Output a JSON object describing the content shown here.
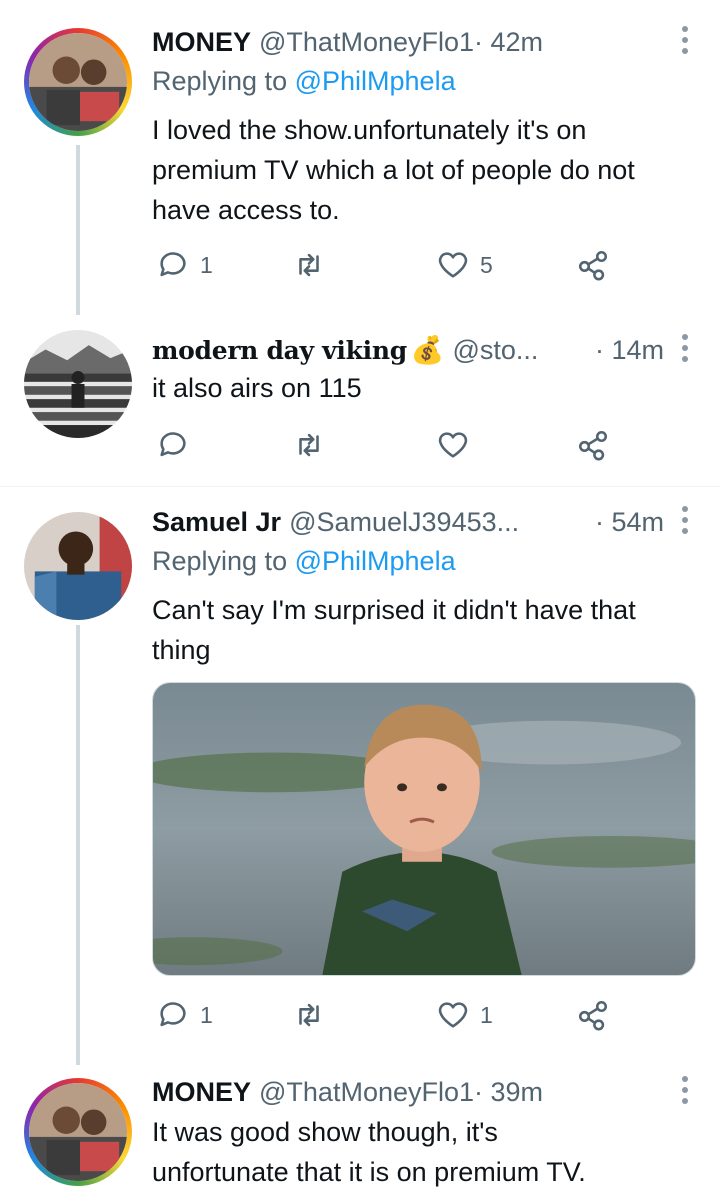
{
  "colors": {
    "link": "#1d9bf0",
    "muted": "#536471",
    "text": "#0f1419",
    "line": "#cfd9de"
  },
  "tweets": [
    {
      "name": "MONEY",
      "handle": "@ThatMoneyFlo1",
      "sep_time": " · 42m",
      "reply_prefix": "Replying to ",
      "reply_mention": "@PhilMphela",
      "line1": "I loved the show.unfortunately it's on",
      "line2": "premium TV which a lot of people do not",
      "line3": "have access to.",
      "replies": "1",
      "retweets": "",
      "likes": "5"
    },
    {
      "name": "modern day viking",
      "emoji": "💰",
      "handle": "@sto...",
      "sep_time": "· 14m",
      "line1": "it also airs on 115",
      "replies": "",
      "retweets": "",
      "likes": ""
    },
    {
      "name": "Samuel Jr",
      "handle": "@SamuelJ39453...",
      "sep_time": "· 54m",
      "reply_prefix": "Replying to ",
      "reply_mention": "@PhilMphela",
      "line1": "Can't say I'm surprised it didn't have that",
      "line2": "thing",
      "media_description_icon": "photo-icon",
      "replies": "1",
      "retweets": "",
      "likes": "1"
    },
    {
      "name": "MONEY",
      "handle": "@ThatMoneyFlo1",
      "sep_time": " · 39m",
      "line1": "It was good show though, it's",
      "line2": "unfortunate that it is on premium TV."
    }
  ]
}
